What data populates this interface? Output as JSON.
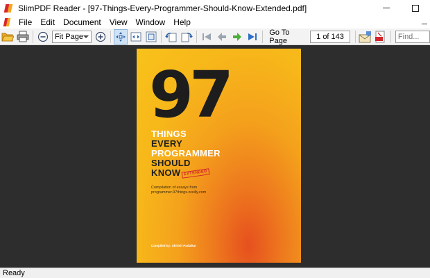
{
  "window": {
    "title": "SlimPDF Reader - [97-Things-Every-Programmer-Should-Know-Extended.pdf]",
    "minimize_glyph": "",
    "maximize_glyph": ""
  },
  "menu": {
    "items": [
      {
        "label": "File"
      },
      {
        "label": "Edit"
      },
      {
        "label": "Document"
      },
      {
        "label": "View"
      },
      {
        "label": "Window"
      },
      {
        "label": "Help"
      }
    ]
  },
  "toolbar": {
    "icons": [
      "open-folder-icon",
      "print-icon",
      "zoom-out-icon",
      "zoom-in-icon",
      "fit-page-icon",
      "fit-width-icon",
      "actual-size-icon",
      "rotate-left-icon",
      "rotate-right-icon",
      "first-page-icon",
      "previous-page-icon",
      "next-page-icon",
      "last-page-icon",
      "email-icon",
      "pdf-export-icon"
    ],
    "zoom_select": {
      "value": "Fit Page"
    },
    "goto_label": "Go To Page",
    "page_field": {
      "value": "1 of 143"
    },
    "find_field": {
      "placeholder": "Find..."
    }
  },
  "document": {
    "cover": {
      "number": "97",
      "title_lines": [
        "THINGS",
        "EVERY",
        "PROGRAMMER",
        "SHOULD",
        "KNOW"
      ],
      "badge": "EXTENDED",
      "compilation_lines": [
        "Compilation of essays from",
        "programmer.97things.oreilly.com"
      ],
      "compiled_by": "Compiled by: Shirish Padalkar"
    }
  },
  "status": {
    "text": "Ready"
  },
  "colors": {
    "workspace_bg": "#2d2d2d",
    "toolbar_bg": "#f3f3f3",
    "cover_yellow": "#f8c21a",
    "cover_orange": "#ee7a1e",
    "nav_gray": "#9aa5b1",
    "nav_green": "#4caf3a",
    "nav_blue": "#2b6fc7"
  }
}
